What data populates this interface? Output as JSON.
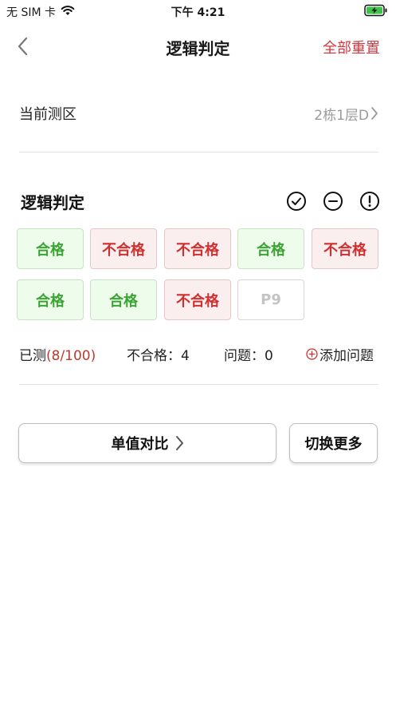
{
  "status_bar": {
    "carrier": "无 SIM 卡",
    "time": "下午 4:21"
  },
  "nav": {
    "title": "逻辑判定",
    "reset_label": "全部重置"
  },
  "area": {
    "label": "当前测区",
    "value": "2栋1层D"
  },
  "section": {
    "title": "逻辑判定",
    "icons": [
      "check-circle-icon",
      "minus-circle-icon",
      "exclamation-circle-icon"
    ]
  },
  "results": [
    {
      "label": "合格",
      "status": "pass"
    },
    {
      "label": "不合格",
      "status": "fail"
    },
    {
      "label": "不合格",
      "status": "fail"
    },
    {
      "label": "合格",
      "status": "pass"
    },
    {
      "label": "不合格",
      "status": "fail"
    },
    {
      "label": "合格",
      "status": "pass"
    },
    {
      "label": "合格",
      "status": "pass"
    },
    {
      "label": "不合格",
      "status": "fail"
    },
    {
      "label": "P9",
      "status": "pending"
    }
  ],
  "stats": {
    "measured_label": "已测",
    "measured_value": "(8/100)",
    "fail_text": "不合格：4",
    "issue_text": "问题：0",
    "add_issue_label": "添加问题"
  },
  "buttons": {
    "compare_label": "单值对比",
    "switch_label": "切换更多"
  },
  "colors": {
    "accent_red": "#d9363e",
    "pass_green": "#3ba534",
    "fail_red": "#d0302f"
  }
}
